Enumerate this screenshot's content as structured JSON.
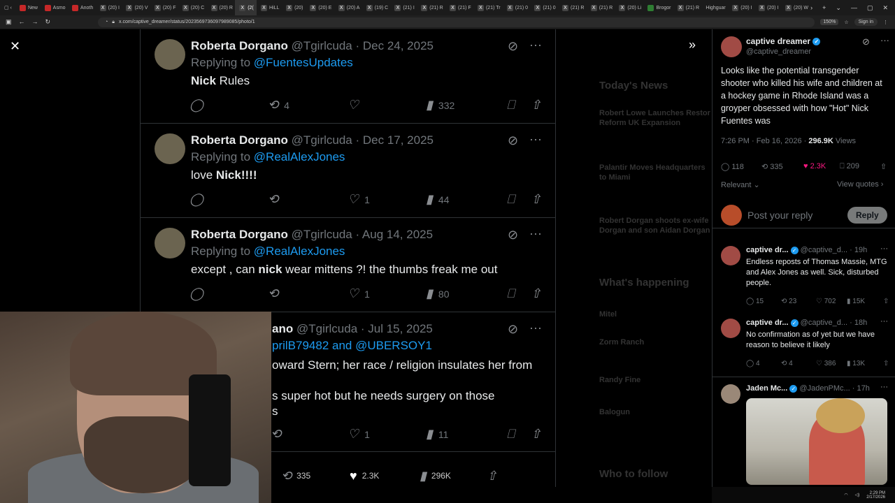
{
  "browser": {
    "tabs": [
      {
        "label": "New",
        "fav": "red"
      },
      {
        "label": "Asmo",
        "fav": "red"
      },
      {
        "label": "Anoth",
        "fav": "red"
      },
      {
        "label": "(20) I",
        "fav": "x"
      },
      {
        "label": "(20) V",
        "fav": "x"
      },
      {
        "label": "(20) F",
        "fav": "x"
      },
      {
        "label": "(20) C",
        "fav": "x"
      },
      {
        "label": "(20) R",
        "fav": "x"
      },
      {
        "label": "(2(",
        "fav": "x",
        "active": true
      },
      {
        "label": "HiLL",
        "fav": "x"
      },
      {
        "label": "(20)",
        "fav": "x"
      },
      {
        "label": "(20) E",
        "fav": "x"
      },
      {
        "label": "(20) A",
        "fav": "x"
      },
      {
        "label": "(19) C",
        "fav": "x"
      },
      {
        "label": "(21) I",
        "fav": "x"
      },
      {
        "label": "(21) R",
        "fav": "x"
      },
      {
        "label": "(21) F",
        "fav": "x"
      },
      {
        "label": "(21) Tr",
        "fav": "x"
      },
      {
        "label": "(21) 0",
        "fav": "x"
      },
      {
        "label": "(21) 0",
        "fav": "x"
      },
      {
        "label": "(21) R",
        "fav": "x"
      },
      {
        "label": "(21) R",
        "fav": "x"
      },
      {
        "label": "(20) Li",
        "fav": "x"
      },
      {
        "label": "Brogor",
        "fav": "green"
      },
      {
        "label": "(21) R",
        "fav": "x"
      },
      {
        "label": "Highguar",
        "fav": "none"
      },
      {
        "label": "(20) I",
        "fav": "x"
      },
      {
        "label": "(20) I",
        "fav": "x"
      },
      {
        "label": "(20) W",
        "fav": "x"
      }
    ],
    "url": "x.com/captive_dreamer/status/2023569736097989085/photo/1",
    "zoom": "150%",
    "signin": "Sign in"
  },
  "ghost": {
    "todays_news": "Today's News",
    "news1": "Robert Lowe Launches Restor",
    "news1b": "Reform UK Expansion",
    "news2": "Palantir Moves Headquarters",
    "news2b": "to Miami",
    "news3": "Robert Dorgan shoots ex-wife",
    "news3b": "Dorgan and son Aidan Dorgan",
    "whats_happening": "What's happening",
    "wh1": "Mitel",
    "wh2": "Zorm Ranch",
    "wh3": "Randy Fine",
    "wh4": "Balogun",
    "who_to_follow": "Who to follow"
  },
  "tweets": [
    {
      "name": "Roberta Dorgano",
      "meta": "@Tgirlcuda · Dec 24, 2025",
      "replying_prefix": "Replying to ",
      "replying": "@FuentesUpdates",
      "text_bold": "Nick",
      "text_rest": " Rules",
      "reposts": "4",
      "likes": "",
      "views": "332"
    },
    {
      "name": "Roberta Dorgano",
      "meta": "@Tgirlcuda · Dec 17, 2025",
      "replying_prefix": "Replying to ",
      "replying": "@RealAlexJones",
      "text_pre": "love ",
      "text_bold": "Nick!!!!",
      "reposts": "",
      "likes": "1",
      "views": "44"
    },
    {
      "name": "Roberta Dorgano",
      "meta": "@Tgirlcuda · Aug 14, 2025",
      "replying_prefix": "Replying to ",
      "replying": "@RealAlexJones",
      "text_pre": "except , can ",
      "text_bold": "nick",
      "text_rest": " wear mittens ?! the thumbs freak me out",
      "reposts": "",
      "likes": "1",
      "views": "80"
    },
    {
      "name": "ano",
      "meta": "@Tgirlcuda · Jul 15, 2025",
      "replying": "prilB79482 and @UBERSOY1",
      "line1": "oward Stern; her race / religion insulates her from",
      "line2": "s super hot but he needs surgery on those",
      "line3": "s",
      "reposts": "",
      "likes": "1",
      "views": "11"
    }
  ],
  "bottom_bar": {
    "reposts": "335",
    "likes": "2.3K",
    "views": "296K"
  },
  "main_post": {
    "name": "captive dreamer",
    "handle": "@captive_dreamer",
    "text": "Looks like the potential transgender shooter who killed his wife and children at a hockey game in Rhode Island was a groyper obsessed with how \"Hot\" Nick Fuentes was",
    "time": "7:26 PM · Feb 16, 2026 · ",
    "views": "296.9K",
    "views_label": " Views",
    "replies": "118",
    "reposts": "335",
    "likes": "2.3K",
    "bookmarks": "209",
    "sort": "Relevant",
    "view_quotes": "View quotes",
    "reply_placeholder": "Post your reply",
    "reply_button": "Reply"
  },
  "replies": [
    {
      "name": "captive dr...",
      "handle": "@captive_d... · 19h",
      "text": "Endless reposts of Thomas Massie, MTG and Alex Jones as well.  Sick, disturbed people.",
      "replies": "15",
      "reposts": "23",
      "likes": "702",
      "views": "15K"
    },
    {
      "name": "captive dr...",
      "handle": "@captive_d... · 18h",
      "text": "No confirmation as of yet but we have reason to believe it likely",
      "replies": "4",
      "reposts": "4",
      "likes": "386",
      "views": "13K"
    },
    {
      "name": "Jaden Mc...",
      "handle": "@JadenPMc... · 17h"
    }
  ],
  "taskbar": {
    "time": "2:29 PM",
    "date": "2/17/2026"
  },
  "colors": {
    "accent": "#1d9bf0",
    "like": "#f91880",
    "bg": "#000000"
  }
}
